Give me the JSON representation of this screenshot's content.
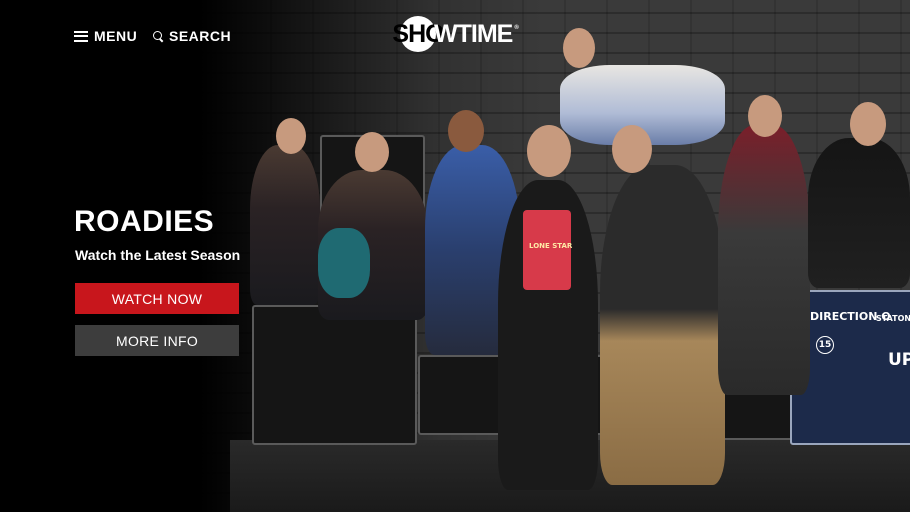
{
  "nav": {
    "menu_label": "MENU",
    "search_label": "SEARCH"
  },
  "brand": {
    "logo_letters": "SHO",
    "logo_rest": "WTIME",
    "logo_mark": "®"
  },
  "hero": {
    "title": "ROADIES",
    "subtitle": "Watch the Latest Season",
    "primary_button": "WATCH NOW",
    "secondary_button": "MORE INFO",
    "case_text_1": "DIRECTION O",
    "case_text_2": "STATON-",
    "case_text_3": "UP",
    "case_number": "15",
    "shirt_text": "LONE STAR"
  },
  "colors": {
    "primary_button": "#c8161c",
    "secondary_button": "#3d3d3d",
    "background": "#000000"
  },
  "icons": {
    "menu": "hamburger-icon",
    "search": "search-icon"
  }
}
